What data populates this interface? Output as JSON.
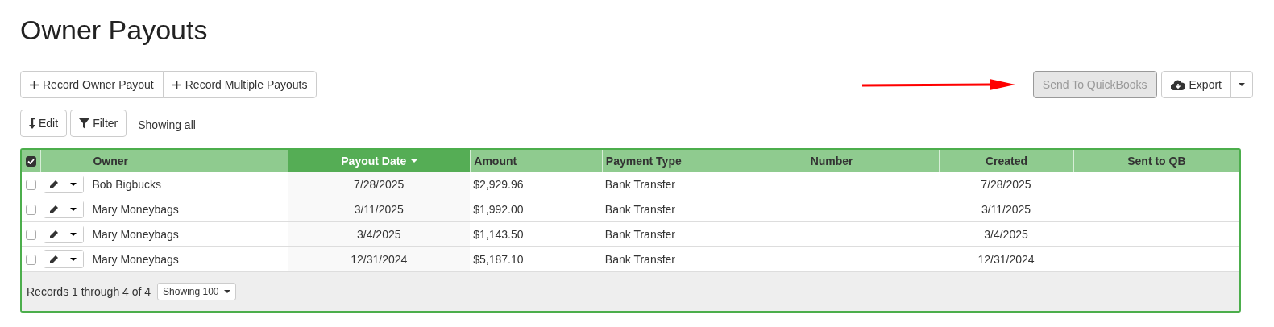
{
  "title": "Owner Payouts",
  "record_buttons": [
    "Record Owner Payout",
    "Record Multiple Payouts"
  ],
  "send_button": {
    "label": "Send To QuickBooks",
    "disabled": true
  },
  "export_button": {
    "label": "Export"
  },
  "edit_button": "Edit",
  "filter_button": "Filter",
  "filter_status": "Showing all",
  "table": {
    "select_all": {
      "checked": true
    },
    "columns": [
      {
        "label": "Owner",
        "kind": "text",
        "sorted": false
      },
      {
        "label": "Payout Date",
        "kind": "date",
        "sorted": true
      },
      {
        "label": "Amount",
        "kind": "text",
        "sorted": false
      },
      {
        "label": "Payment Type",
        "kind": "text",
        "sorted": false
      },
      {
        "label": "Number",
        "kind": "text",
        "sorted": false
      },
      {
        "label": "Created",
        "kind": "date",
        "sorted": false
      },
      {
        "label": "Sent to QB",
        "kind": "flag",
        "sorted": false
      }
    ],
    "rows": [
      {
        "checked": false,
        "cells": [
          "Bob Bigbucks",
          "7/28/2025",
          "$2,929.96",
          "Bank Transfer",
          "",
          "7/28/2025",
          ""
        ]
      },
      {
        "checked": false,
        "cells": [
          "Mary Moneybags",
          "3/11/2025",
          "$1,992.00",
          "Bank Transfer",
          "",
          "3/11/2025",
          ""
        ]
      },
      {
        "checked": false,
        "cells": [
          "Mary Moneybags",
          "3/4/2025",
          "$1,143.50",
          "Bank Transfer",
          "",
          "3/4/2025",
          ""
        ]
      },
      {
        "checked": false,
        "cells": [
          "Mary Moneybags",
          "12/31/2024",
          "$5,187.10",
          "Bank Transfer",
          "",
          "12/31/2024",
          ""
        ]
      }
    ]
  },
  "footer": {
    "records": "Records 1 through 4 of 4",
    "page_size": "Showing 100"
  }
}
